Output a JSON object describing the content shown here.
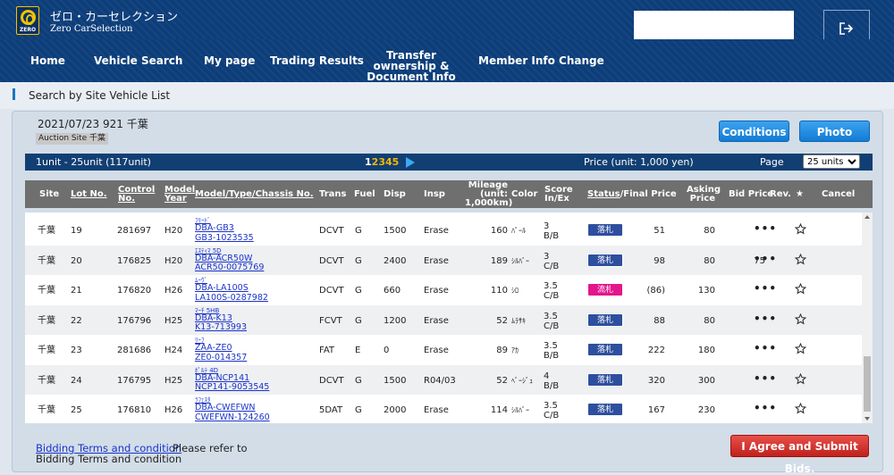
{
  "header": {
    "brand_jp": "ゼロ・カーセレクション",
    "brand_en": "Zero CarSelection",
    "logo_text": "ZERO",
    "logout_icon": "logout-icon"
  },
  "nav": {
    "items": [
      "Home",
      "Vehicle Search",
      "My page",
      "Trading Results",
      "Transfer ownership &",
      "Document Info",
      "Member Info Change"
    ]
  },
  "subbar": {
    "title": "Search by Site Vehicle List"
  },
  "auction": {
    "date_title": "2021/07/23 921 千葉",
    "site_tag": "Auction Site 千葉",
    "conditions_label": "Conditions",
    "photo_label": "Photo"
  },
  "infobar": {
    "range": "1unit - 25unit (117unit)",
    "pages": [
      "1",
      "2",
      "3",
      "4",
      "5"
    ],
    "current_page": "1",
    "price_unit": "Price (unit: 1,000 yen)",
    "page_label": "Page",
    "per_page": "25 units"
  },
  "table": {
    "headers": {
      "site": "Site",
      "lot": "Lot No.",
      "control1": "Control",
      "control2": "No.",
      "model1": "Model",
      "model2": "Year",
      "mtc": "Model/Type/Chassis No.",
      "trans": "Trans",
      "fuel": "Fuel",
      "disp": "Disp",
      "insp": "Insp",
      "mileage1": "Mileage",
      "mileage2": "(unit:",
      "mileage3": "1,000km)",
      "color": "Color",
      "score1": "Score",
      "score2": "In/Ex",
      "status": "Status",
      "final": "/Final Price",
      "asking1": "Asking",
      "asking2": "Price",
      "bid": "Bid Price",
      "rev": "Rev.",
      "star": "★",
      "cancel": "Cancel"
    },
    "rows": [
      {
        "site": "千葉",
        "lot": "19",
        "control": "281697",
        "year": "H20",
        "kana": "ﾌﾘｰﾄﾞ",
        "type": "DBA-GB3",
        "chassis": "GB3-1023535",
        "trans": "DCVT",
        "fuel": "G",
        "disp": "1500",
        "insp": "Erase",
        "mileage": "160",
        "color": "ﾊﾟｰﾙ",
        "score_in": "3",
        "score_ex": "B/B",
        "status": "落札",
        "final": "51",
        "asking": "80",
        "bid": "",
        "rev": ""
      },
      {
        "site": "千葉",
        "lot": "20",
        "control": "176825",
        "year": "H20",
        "kana": "ｴｽﾃｨﾏ 5D",
        "type": "DBA-ACR50W",
        "chassis": "ACR50-0075769",
        "trans": "DCVT",
        "fuel": "G",
        "disp": "2400",
        "insp": "Erase",
        "mileage": "189",
        "color": "ｼﾙﾊﾞｰ",
        "score_in": "3",
        "score_ex": "C/B",
        "status": "落札",
        "final": "98",
        "asking": "80",
        "bid": "75",
        "rev": ""
      },
      {
        "site": "千葉",
        "lot": "21",
        "control": "176820",
        "year": "H26",
        "kana": "ﾑｰｳﾞ",
        "type": "DBA-LA100S",
        "chassis": "LA100S-0287982",
        "trans": "DCVT",
        "fuel": "G",
        "disp": "660",
        "insp": "Erase",
        "mileage": "110",
        "color": "ｼﾛ",
        "score_in": "3.5",
        "score_ex": "C/B",
        "status": "流札",
        "final": "(86)",
        "asking": "130",
        "bid": "",
        "rev": ""
      },
      {
        "site": "千葉",
        "lot": "22",
        "control": "176796",
        "year": "H25",
        "kana": "ﾏｰﾁ 5HB",
        "type": "DBA-K13",
        "chassis": "K13-713993",
        "trans": "FCVT",
        "fuel": "G",
        "disp": "1200",
        "insp": "Erase",
        "mileage": "52",
        "color": "ﾑﾗｻｷ",
        "score_in": "3.5",
        "score_ex": "C/B",
        "status": "落札",
        "final": "88",
        "asking": "80",
        "bid": "",
        "rev": ""
      },
      {
        "site": "千葉",
        "lot": "23",
        "control": "281686",
        "year": "H24",
        "kana": "ﾘｰﾌ",
        "type": "ZAA-ZE0",
        "chassis": "ZE0-014357",
        "trans": "FAT",
        "fuel": "E",
        "disp": "0",
        "insp": "Erase",
        "mileage": "89",
        "color": "ｱｶ",
        "score_in": "3.5",
        "score_ex": "B/B",
        "status": "落札",
        "final": "222",
        "asking": "180",
        "bid": "",
        "rev": ""
      },
      {
        "site": "千葉",
        "lot": "24",
        "control": "176795",
        "year": "H25",
        "kana": "ﾎﾟﾙﾃ 4D",
        "type": "DBA-NCP141",
        "chassis": "NCP141-9053545",
        "trans": "DCVT",
        "fuel": "G",
        "disp": "1500",
        "insp": "R04/03",
        "mileage": "52",
        "color": "ﾍﾞｰｼﾞｭ",
        "score_in": "4",
        "score_ex": "B/B",
        "status": "落札",
        "final": "320",
        "asking": "300",
        "bid": "",
        "rev": ""
      },
      {
        "site": "千葉",
        "lot": "25",
        "control": "176810",
        "year": "H26",
        "kana": "ﾗﾌｪｽﾀ",
        "type": "DBA-CWEFWN",
        "chassis": "CWEFWN-124260",
        "trans": "5DAT",
        "fuel": "G",
        "disp": "2000",
        "insp": "Erase",
        "mileage": "114",
        "color": "ｼﾙﾊﾞｰ",
        "score_in": "3.5",
        "score_ex": "C/B",
        "status": "落札",
        "final": "167",
        "asking": "230",
        "bid": "",
        "rev": ""
      }
    ],
    "more_label": "•••"
  },
  "footer": {
    "terms_link": "Bidding Terms and condition",
    "terms_text": "Please refer to",
    "terms_text2": "Bidding Terms and condition",
    "submit_label": "I Agree and Submit Bids."
  },
  "colors": {
    "header_bg": "#0d3e7a",
    "sold": "#2e4f9e",
    "unsold": "#e3168c",
    "submit": "#c0211c",
    "button": "#137bd4"
  }
}
